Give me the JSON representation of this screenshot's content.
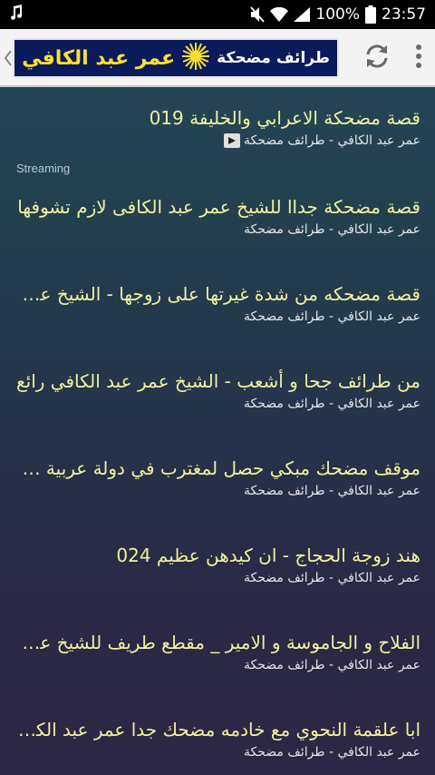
{
  "status_bar": {
    "battery_percent": "100%",
    "time": "23:57"
  },
  "app_bar": {
    "banner_name": "عمر عبد الكافي",
    "banner_subtitle": "طرائف مضحكة"
  },
  "section_label": "Streaming",
  "items": [
    {
      "title": "قصة مضحكة الاعرابي والخليفة 019",
      "subtitle": "عمر عبد الكافي - طرائف مضحكة",
      "playing": true
    },
    {
      "title": "قصة مضحكة جداا للشيخ عمر عبد الكافى لازم تشوفها",
      "subtitle": "عمر عبد الكافي - طرائف مضحكة",
      "playing": false
    },
    {
      "title": "قصة مضحكه من شدة غيرتها على زوجها - الشيخ عمر عبد الكافي",
      "subtitle": "عمر عبد الكافي - طرائف مضحكة",
      "playing": false
    },
    {
      "title": "من طرائف جحا و أشعب - الشيخ عمر عبد الكافي رائع",
      "subtitle": "عمر عبد الكافي - طرائف مضحكة",
      "playing": false
    },
    {
      "title": "موقف مضحك مبكي حصل لمغترب في دولة عربية جميلة",
      "subtitle": "عمر عبد الكافي - طرائف مضحكة",
      "playing": false
    },
    {
      "title": "هند زوجة الحجاج - ان كيدهن عظيم 024",
      "subtitle": "عمر عبد الكافي - طرائف مضحكة",
      "playing": false
    },
    {
      "title": "الفلاح و الجاموسة و الامير _ مقطع طريف للشيخ عمر عبد الكافي",
      "subtitle": "عمر عبد الكافي - طرائف مضحكة",
      "playing": false
    },
    {
      "title": "ابا علقمة النحوي مع خادمه مضحك جدا عمر عبد الكافي",
      "subtitle": "عمر عبد الكافي - طرائف مضحكة",
      "playing": false
    }
  ]
}
